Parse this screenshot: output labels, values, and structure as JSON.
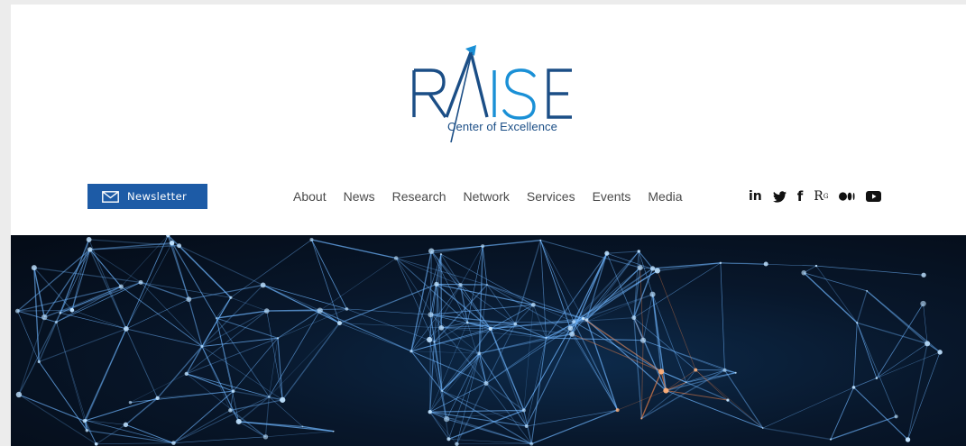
{
  "logo": {
    "main_text": "RAISE",
    "subtitle": "Center of Excellence",
    "primary_color": "#1b4e86",
    "accent_color": "#1a90d6"
  },
  "newsletter": {
    "label": "Newsletter",
    "icon": "mail-icon",
    "background": "#1d5ba6"
  },
  "nav": {
    "items": [
      {
        "label": "About"
      },
      {
        "label": "News"
      },
      {
        "label": "Research"
      },
      {
        "label": "Network"
      },
      {
        "label": "Services"
      },
      {
        "label": "Events"
      },
      {
        "label": "Media"
      }
    ]
  },
  "social": {
    "items": [
      {
        "name": "linkedin-icon",
        "glyph": "in"
      },
      {
        "name": "twitter-icon",
        "glyph": "twitter-bird"
      },
      {
        "name": "facebook-icon",
        "glyph": "f"
      },
      {
        "name": "researchgate-icon",
        "glyph": "R^G"
      },
      {
        "name": "medium-icon",
        "glyph": "●●|"
      },
      {
        "name": "youtube-icon",
        "glyph": "play"
      }
    ]
  },
  "hero": {
    "image": "network-background-image",
    "colors": [
      "#0a1f3c",
      "#4fa8ff",
      "#ff7a3a"
    ]
  }
}
